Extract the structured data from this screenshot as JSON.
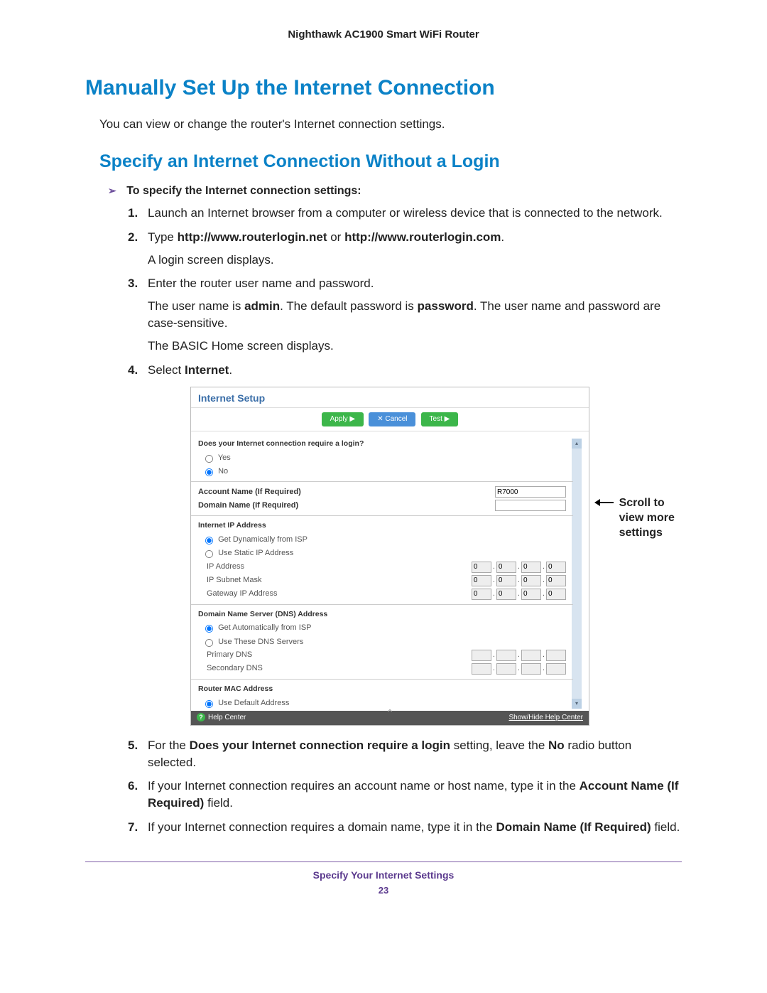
{
  "header": {
    "product": "Nighthawk AC1900 Smart WiFi Router"
  },
  "h1": "Manually Set Up the Internet Connection",
  "intro": "You can view or change the router's Internet connection settings.",
  "h2": "Specify an Internet Connection Without a Login",
  "procedure_title": "To specify the Internet connection settings:",
  "steps": {
    "s1": {
      "num": "1.",
      "text": "Launch an Internet browser from a computer or wireless device that is connected to the network."
    },
    "s2": {
      "num": "2.",
      "prefix": "Type ",
      "url1": "http://www.routerlogin.net",
      "mid": " or ",
      "url2": "http://www.routerlogin.com",
      "suffix": ".",
      "p1": "A login screen displays."
    },
    "s3": {
      "num": "3.",
      "text": "Enter the router user name and password.",
      "p1a": "The user name is ",
      "p1b": "admin",
      "p1c": ". The default password is ",
      "p1d": "password",
      "p1e": ". The user name and password are case-sensitive.",
      "p2": "The BASIC Home screen displays."
    },
    "s4": {
      "num": "4.",
      "prefix": "Select ",
      "bold": "Internet",
      "suffix": "."
    },
    "s5": {
      "num": "5.",
      "a": "For the ",
      "b": "Does your Internet connection require a login",
      "c": " setting, leave the ",
      "d": "No",
      "e": " radio button selected."
    },
    "s6": {
      "num": "6.",
      "a": "If your Internet connection requires an account name or host name, type it in the ",
      "b": "Account Name (If Required)",
      "c": " field."
    },
    "s7": {
      "num": "7.",
      "a": "If your Internet connection requires a domain name, type it in the ",
      "b": "Domain Name (If Required)",
      "c": " field."
    }
  },
  "screenshot": {
    "title": "Internet Setup",
    "buttons": {
      "apply": "Apply ▶",
      "cancel": "✕ Cancel",
      "test": "Test  ▶"
    },
    "q_login": "Does your Internet connection require a login?",
    "yes": "Yes",
    "no": "No",
    "account_name_label": "Account Name  (If Required)",
    "account_name_value": "R7000",
    "domain_name_label": "Domain Name  (If Required)",
    "ip_section": "Internet IP Address",
    "ip_dyn": "Get Dynamically from ISP",
    "ip_static": "Use Static IP Address",
    "ip_address": "IP Address",
    "ip_subnet": "IP Subnet Mask",
    "ip_gateway": "Gateway IP Address",
    "dns_section": "Domain Name Server (DNS) Address",
    "dns_auto": "Get Automatically from ISP",
    "dns_manual": "Use These DNS Servers",
    "dns_primary": "Primary DNS",
    "dns_secondary": "Secondary DNS",
    "mac_section": "Router MAC Address",
    "mac_default": "Use Default Address",
    "help_left": "Help Center",
    "help_right": "Show/Hide Help Center",
    "oct": "0"
  },
  "callout": "Scroll to view more settings",
  "footer": {
    "section": "Specify Your Internet Settings",
    "page": "23"
  }
}
